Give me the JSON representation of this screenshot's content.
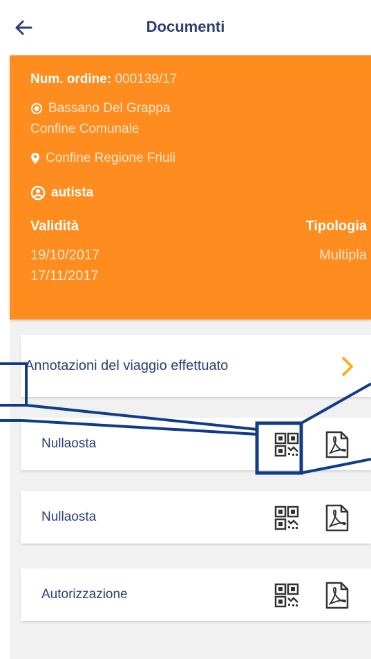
{
  "header": {
    "title": "Documenti",
    "back_icon": "arrow-left-icon"
  },
  "order_card": {
    "order_label": "Num. ordine:",
    "order_value": "000139/17",
    "origin_line1": "Bassano Del Grappa",
    "origin_line2": "Confine Comunale",
    "destination": "Confine Regione Friuli",
    "driver": "autista",
    "validity_label": "Validità",
    "validity_from": "19/10/2017",
    "validity_to": "17/11/2017",
    "type_label": "Tipologia",
    "type_value": "Multipla",
    "accent_color": "#ff8c1e"
  },
  "trip_notes": {
    "label": "Annotazioni del viaggio effettuato"
  },
  "documents": [
    {
      "label": "Nullaosta"
    },
    {
      "label": "Nullaosta"
    },
    {
      "label": "Autorizzazione"
    }
  ],
  "colors": {
    "title": "#2d3e73",
    "orange": "#ff8c1e",
    "chevron": "#f5b21a",
    "annotation": "#103b86"
  }
}
